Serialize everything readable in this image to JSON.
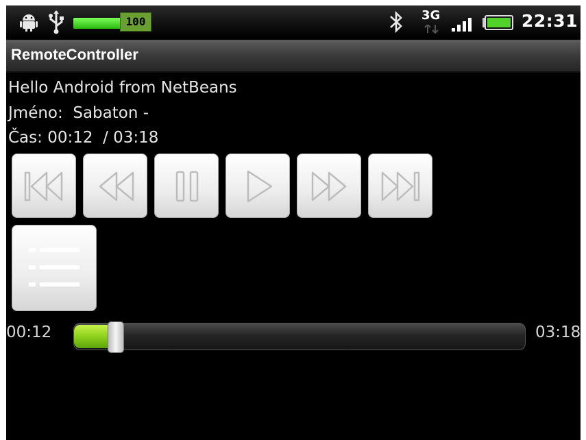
{
  "status_bar": {
    "icons_left": [
      "android-icon",
      "usb-icon",
      "battery-full-icon",
      "battery-level-badge"
    ],
    "battery_badge": "100",
    "icons_right": [
      "bluetooth-icon",
      "3g-data-icon",
      "signal-icon",
      "battery-icon"
    ],
    "network_label": "3G",
    "time": "22:31"
  },
  "app": {
    "title": "RemoteController"
  },
  "info": {
    "hello": "Hello Android from NetBeans",
    "name_line": "Jméno:  Sabaton -",
    "time_line": "Čas: 00:12  / 03:18"
  },
  "controls": [
    {
      "name": "skip-previous",
      "icon": "skip-previous-icon"
    },
    {
      "name": "rewind",
      "icon": "rewind-icon"
    },
    {
      "name": "pause",
      "icon": "pause-icon"
    },
    {
      "name": "play",
      "icon": "play-icon"
    },
    {
      "name": "fast-forward",
      "icon": "fast-forward-icon"
    },
    {
      "name": "skip-next",
      "icon": "skip-next-icon"
    }
  ],
  "playlist_button": {
    "icon": "list-icon"
  },
  "seekbar": {
    "current": "00:12",
    "total": "03:18",
    "progress": 0.06
  },
  "colors": {
    "accent_green": "#8ed01b",
    "background": "#000000",
    "text": "#e6e6e6"
  }
}
